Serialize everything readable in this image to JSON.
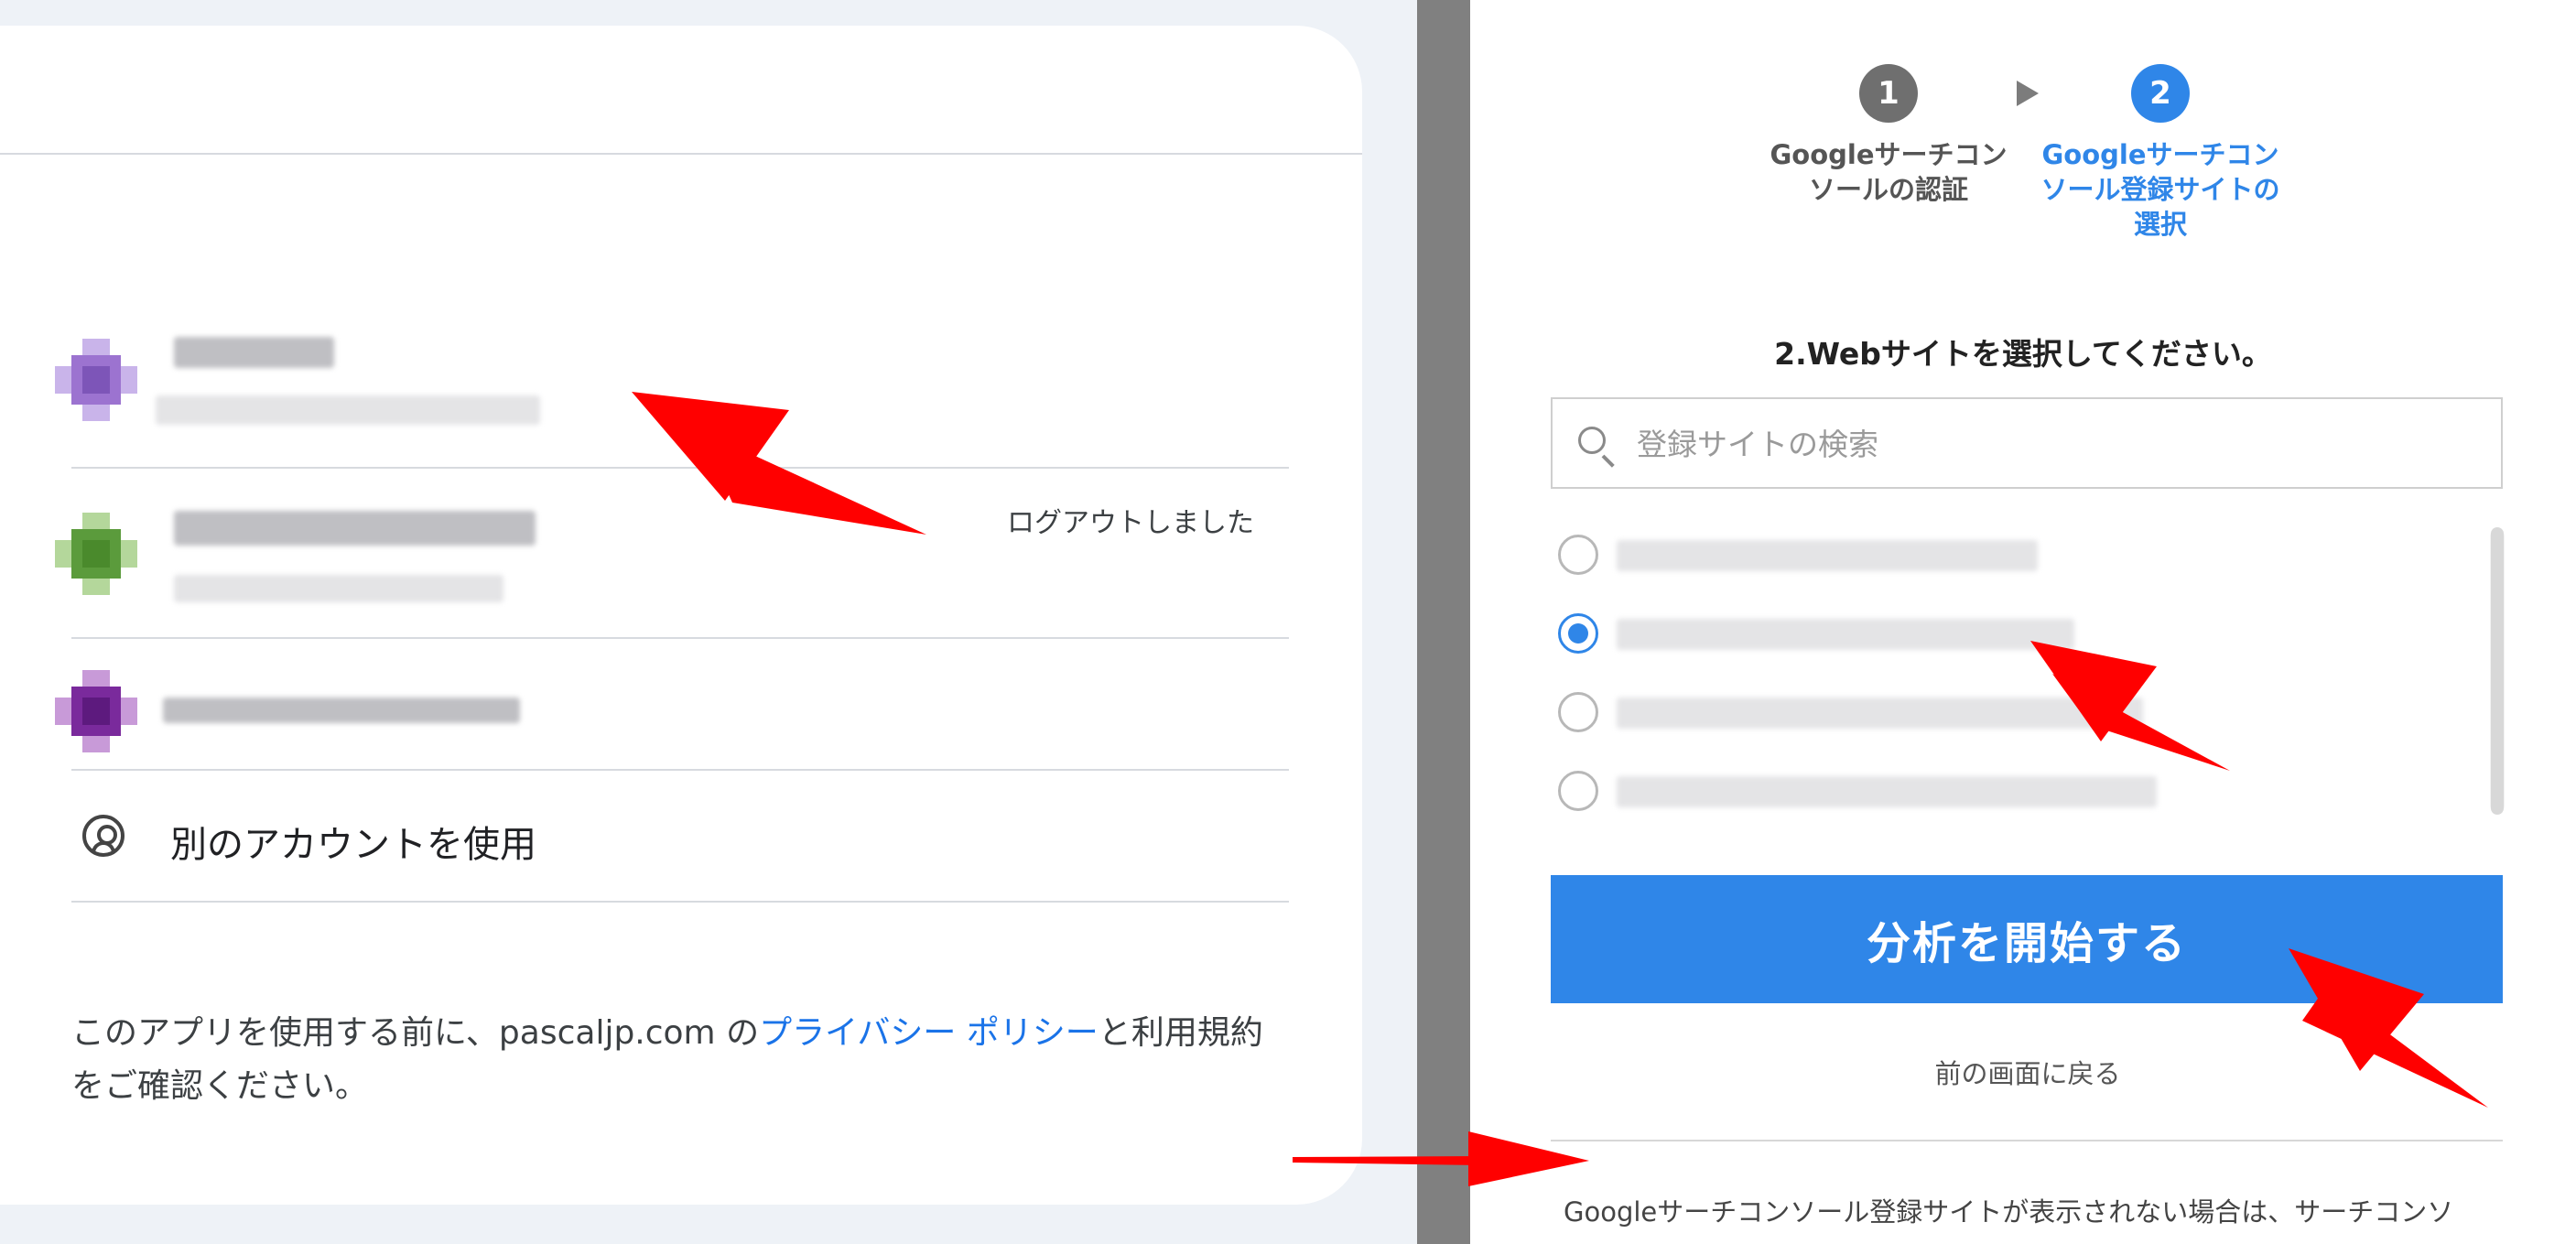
{
  "left_panel": {
    "logout_status": "ログアウトしました",
    "accounts": [
      {
        "avatar_color": "#9c73d0"
      },
      {
        "avatar_color": "#5b9b3c"
      },
      {
        "avatar_color": "#7a2a9c"
      }
    ],
    "use_another_account": "別のアカウントを使用",
    "consent": {
      "before_link": "このアプリを使用する前に、pascaljp.com の",
      "link": "プライバシー ポリシー",
      "after_link": "と利用規約をご確認ください。"
    }
  },
  "right_panel": {
    "steps": [
      {
        "number": "1",
        "label": "Googleサーチコンソールの認証",
        "active": false
      },
      {
        "number": "2",
        "label": "Googleサーチコンソール登録サイトの選択",
        "active": true
      }
    ],
    "section_heading": "2.Webサイトを選択してください。",
    "search": {
      "placeholder": "登録サイトの検索",
      "value": ""
    },
    "sites": [
      {
        "checked": false
      },
      {
        "checked": true
      },
      {
        "checked": false
      },
      {
        "checked": false
      }
    ],
    "start_button": "分析を開始する",
    "back_link": "前の画面に戻る",
    "help_text": "Googleサーチコンソール登録サイトが表示されない場合は、サーチコンソ"
  },
  "colors": {
    "accent_blue": "#2f86e8",
    "google_link_blue": "#1a73e8",
    "annotation_red": "#ff0000",
    "step_inactive": "#6f6f6f",
    "divider": "#808080"
  },
  "icons": [
    "account-circle-icon",
    "search-icon",
    "step-arrow-icon"
  ]
}
